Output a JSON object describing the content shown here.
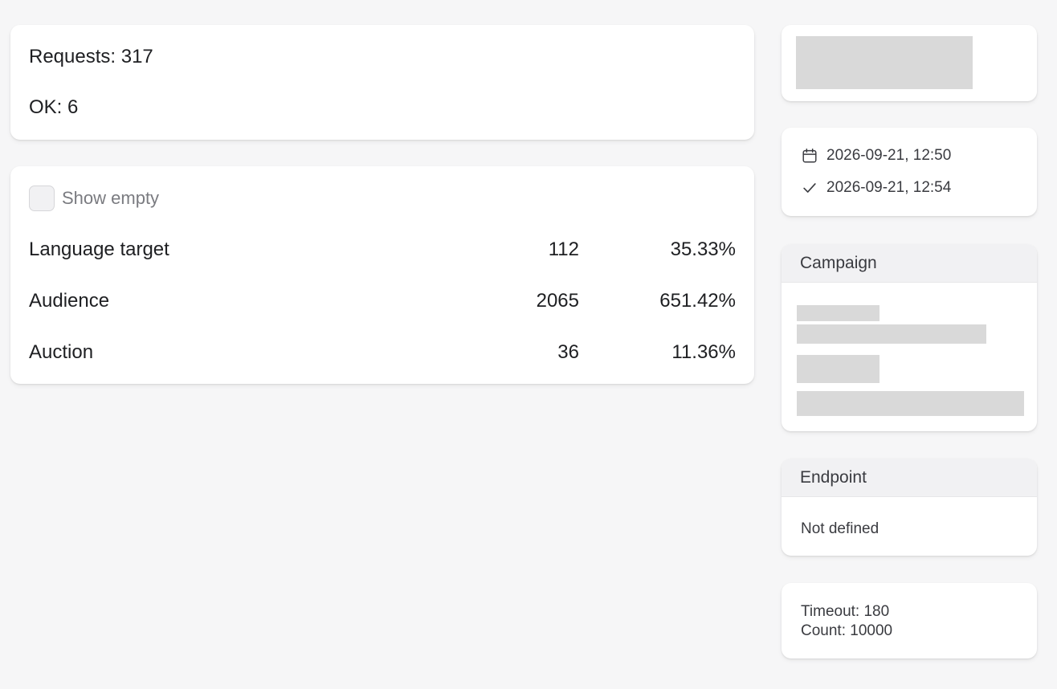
{
  "summary": {
    "requests": "Requests: 317",
    "ok": "OK: 6"
  },
  "stats": {
    "show_empty_label": "Show empty",
    "rows": [
      {
        "name": "Language target",
        "count": "112",
        "percent": "35.33%"
      },
      {
        "name": "Audience",
        "count": "2065",
        "percent": "651.42%"
      },
      {
        "name": "Auction",
        "count": "36",
        "percent": "11.36%"
      }
    ]
  },
  "dates": {
    "created": "2026-09-21, 12:50",
    "completed": "2026-09-21, 12:54"
  },
  "campaign": {
    "title": "Campaign"
  },
  "endpoint": {
    "title": "Endpoint",
    "value": "Not defined"
  },
  "settings": {
    "timeout": "Timeout: 180",
    "count": "Count: 10000"
  },
  "icons": {
    "date": "calendar-icon",
    "done": "checkmark-icon"
  },
  "colors": {
    "background": "#f6f6f7",
    "card": "#ffffff",
    "skeleton": "#d9d9d9",
    "header": "#f1f1f3"
  }
}
